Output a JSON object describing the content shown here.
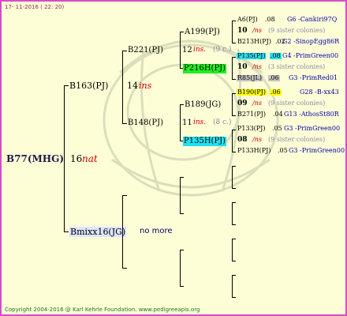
{
  "header_date": "17- 11-2016 ( 22: 20)",
  "footer": "Copyright 2004-2016 @ Karl Kehrle Foundation.   www.pedigreeapis.org",
  "root": {
    "name": "B77(MHG)",
    "year": "16",
    "suffix": "nat"
  },
  "gen1": [
    {
      "name": "B163(PJ)",
      "year": "14",
      "suffix": "ins"
    },
    {
      "name": "Bmixx16(JG)",
      "note": "no more"
    }
  ],
  "gen2": [
    {
      "name": "B221(PJ)",
      "year": "12",
      "suffix": "ins.",
      "siblings": "(9 c.)"
    },
    {
      "name": "B148(PJ)",
      "year": "11",
      "suffix": "ins.",
      "siblings": "(8 c.)"
    }
  ],
  "gen3": [
    {
      "name": "A199(PJ)"
    },
    {
      "name": "P216H(PJ)"
    },
    {
      "name": "B189(JG)"
    },
    {
      "name": "P135H(PJ)"
    }
  ],
  "gen4": [
    {
      "name": "A6(PJ)",
      "num": ".08",
      "origin": "G6 -Cankiri97Q"
    },
    {
      "year": "10",
      "suffix": "/ns",
      "siblings": "(9 sister colonies)"
    },
    {
      "name": "B213H(PJ)",
      "num": ".02",
      "origin": "G2 -SinopEgg86R"
    },
    {
      "name": "P135(PJ)",
      "num": ".08",
      "origin": "G4 -PrimGreen00"
    },
    {
      "year": "10",
      "suffix": "/ns",
      "siblings": "(3 sister colonies)"
    },
    {
      "name": "R85(JL)",
      "num": ".06",
      "origin": "G3 -PrimRed01"
    },
    {
      "name": "B190(PJ)",
      "num": ".06",
      "origin": "G28 -B-xx43"
    },
    {
      "year": "09",
      "suffix": "/ns",
      "siblings": "(9 sister colonies)"
    },
    {
      "name": "B271(PJ)",
      "num": ".04",
      "origin": "G13 -AthosSt80R"
    },
    {
      "name": "P133(PJ)",
      "num": ".05",
      "origin": "G3 -PrimGreen00"
    },
    {
      "year": "08",
      "suffix": "/ns",
      "siblings": "(9 sister colonies)"
    },
    {
      "name": "P133H(PJ)",
      "num": ".05",
      "origin": "G3 -PrimGreen00"
    }
  ],
  "colors": {
    "border": "#d84cc8",
    "background": "#fdfdd6",
    "cyan": "#22e0f0",
    "green": "#22ee22",
    "yellow": "#ffff00",
    "grey": "#c4c4c4"
  }
}
